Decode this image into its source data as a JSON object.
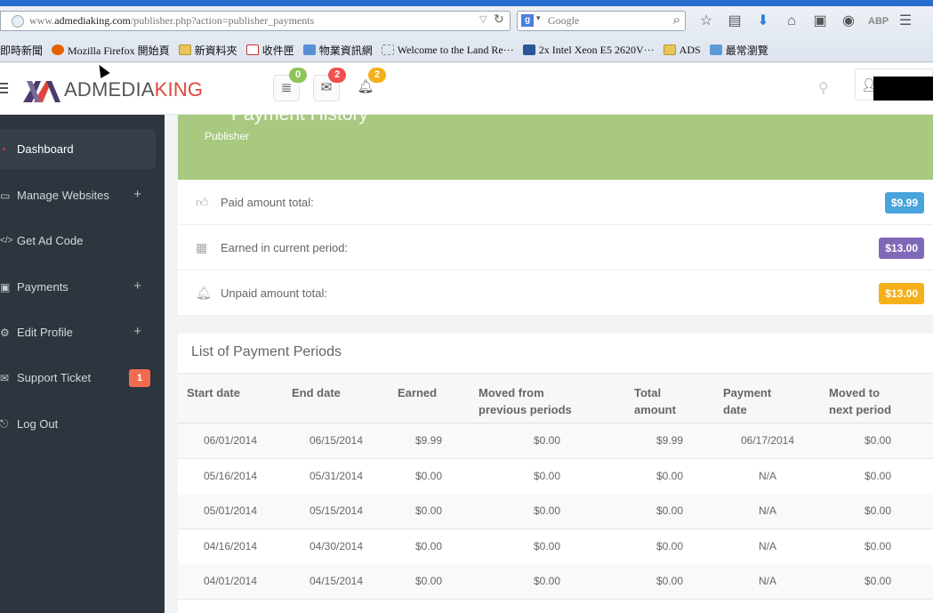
{
  "browser": {
    "url_prefix": "www.",
    "url_domain": "admediaking.com",
    "url_path": "/publisher.php?action=publisher_payments",
    "search_engine": "Google",
    "bookmarks": [
      {
        "label": "即時新聞",
        "icon": "news-icon"
      },
      {
        "label": "Mozilla Firefox 開始頁",
        "icon": "firefox-icon"
      },
      {
        "label": "新資料夾",
        "icon": "folder-icon"
      },
      {
        "label": "收件匣",
        "icon": "gmail-icon"
      },
      {
        "label": "物業資訊網",
        "icon": "chart-icon"
      },
      {
        "label": "Welcome to the Land Re···",
        "icon": "page-icon"
      },
      {
        "label": "2x Intel Xeon E5 2620V···",
        "icon": "word-icon"
      },
      {
        "label": "ADS",
        "icon": "folder-icon"
      },
      {
        "label": "最常瀏覽",
        "icon": "search-folder-icon"
      }
    ]
  },
  "header": {
    "logo_part1": "ADMEDIA",
    "logo_part2": "KING",
    "badges": {
      "tasks": "0",
      "mail": "2",
      "alerts": "2"
    },
    "badge_colors": {
      "tasks": "#8fc45a",
      "mail": "#f05050",
      "alerts": "#f5b01a"
    }
  },
  "sidebar": {
    "items": [
      {
        "label": "Dashboard",
        "icon": "dashboard-icon",
        "active": true
      },
      {
        "label": "Manage Websites",
        "icon": "laptop-icon",
        "expand": "+"
      },
      {
        "label": "Get Ad Code",
        "icon": "code-icon"
      },
      {
        "label": "Payments",
        "icon": "payments-icon",
        "expand": "+"
      },
      {
        "label": "Edit Profile",
        "icon": "profile-icon",
        "expand": "+"
      },
      {
        "label": "Support Ticket",
        "icon": "ticket-icon",
        "badge": "1"
      },
      {
        "label": "Log Out",
        "icon": "logout-icon"
      }
    ]
  },
  "page": {
    "title": "Payment History",
    "subtitle": "Publisher"
  },
  "stats": [
    {
      "label": "Paid amount total:",
      "value": "$9.99",
      "color": "#48a4db",
      "icon": "thumbs-up-icon"
    },
    {
      "label": "Earned in current period:",
      "value": "$13.00",
      "color": "#8068b8",
      "icon": "calendar-icon"
    },
    {
      "label": "Unpaid amount total:",
      "value": "$13.00",
      "color": "#f5b01a",
      "icon": "bell-icon"
    }
  ],
  "periods": {
    "title": "List of Payment Periods",
    "headers": [
      "Start date",
      "End date",
      "Earned",
      "Moved from\nprevious periods",
      "Total\namount",
      "Payment\ndate",
      "Moved to\nnext period"
    ],
    "rows": [
      [
        "06/01/2014",
        "06/15/2014",
        "$9.99",
        "$0.00",
        "$9.99",
        "06/17/2014",
        "$0.00"
      ],
      [
        "05/16/2014",
        "05/31/2014",
        "$0.00",
        "$0.00",
        "$0.00",
        "N/A",
        "$0.00"
      ],
      [
        "05/01/2014",
        "05/15/2014",
        "$0.00",
        "$0.00",
        "$0.00",
        "N/A",
        "$0.00"
      ],
      [
        "04/16/2014",
        "04/30/2014",
        "$0.00",
        "$0.00",
        "$0.00",
        "N/A",
        "$0.00"
      ],
      [
        "04/01/2014",
        "04/15/2014",
        "$0.00",
        "$0.00",
        "$0.00",
        "N/A",
        "$0.00"
      ]
    ]
  }
}
